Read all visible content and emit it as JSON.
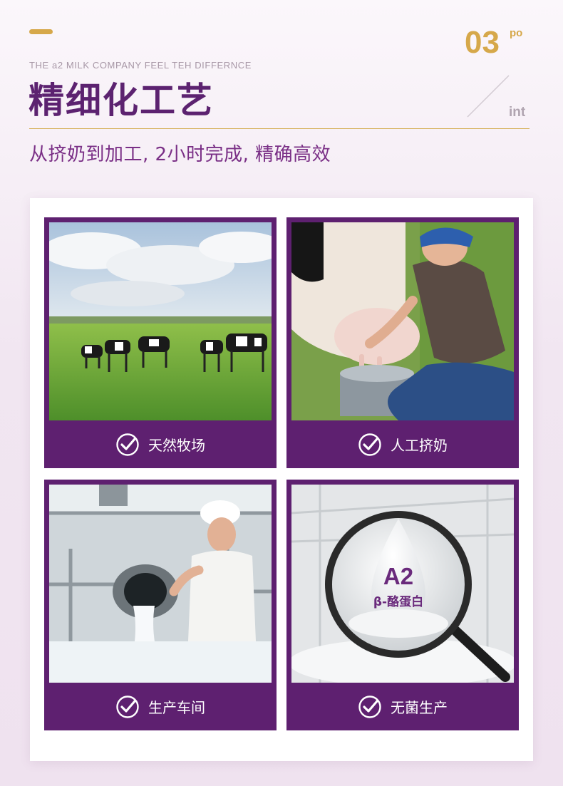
{
  "header": {
    "eyebrow": "THE a2 MILK COMPANY FEEL TEH DIFFERNCE",
    "title": "精细化工艺",
    "number": "03",
    "number_sup": "po",
    "corner_word": "int",
    "subtitle": "从挤奶到加工, 2小时完成, 精确高效"
  },
  "cards": [
    {
      "label": "天然牧场",
      "image": "cows-grazing-pasture"
    },
    {
      "label": "人工挤奶",
      "image": "woman-hand-milking-cow"
    },
    {
      "label": "生产车间",
      "image": "worker-pouring-milk-factory"
    },
    {
      "label": "无菌生产",
      "image": "magnifier-milk-drop"
    }
  ],
  "magnifier": {
    "line1": "A2",
    "line2": "β-酪蛋白"
  },
  "colors": {
    "brand_purple": "#5e2070",
    "title_purple": "#5c2270",
    "gold": "#d6a84a"
  }
}
